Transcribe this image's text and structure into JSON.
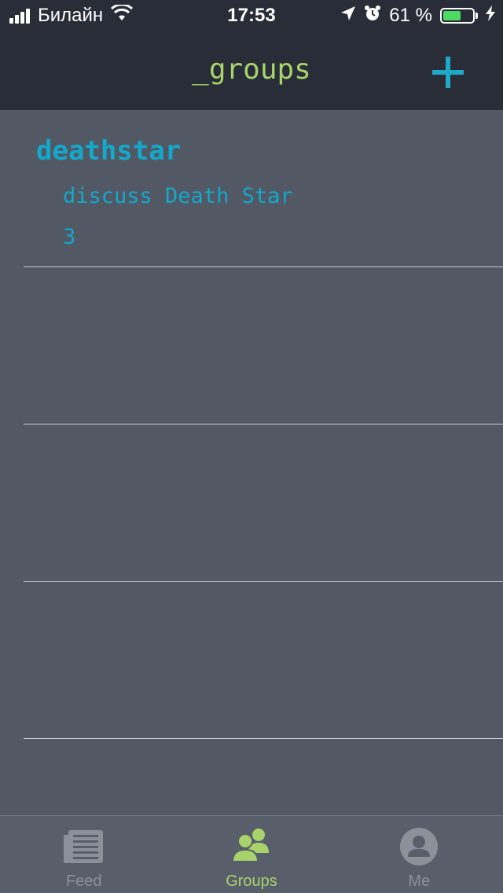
{
  "status_bar": {
    "carrier": "Билайн",
    "time": "17:53",
    "battery_text": "61 %",
    "battery_level": 0.61,
    "icons": [
      "signal-icon",
      "wifi-icon",
      "location-icon",
      "alarm-icon",
      "battery-icon",
      "charging-icon"
    ]
  },
  "nav": {
    "title": "_groups",
    "add_icon": "plus-icon"
  },
  "groups": [
    {
      "name": "deathstar",
      "description": "discuss Death Star",
      "count": "3"
    }
  ],
  "tabs": [
    {
      "label": "Feed",
      "icon": "newspaper-icon",
      "active": false
    },
    {
      "label": "Groups",
      "icon": "people-icon",
      "active": true
    },
    {
      "label": "Me",
      "icon": "user-icon",
      "active": false
    }
  ],
  "colors": {
    "header_bg": "#292d37",
    "content_bg": "#535865",
    "accent_green": "#a8d36b",
    "accent_blue": "#12a9cc",
    "battery_green": "#4cd964"
  }
}
